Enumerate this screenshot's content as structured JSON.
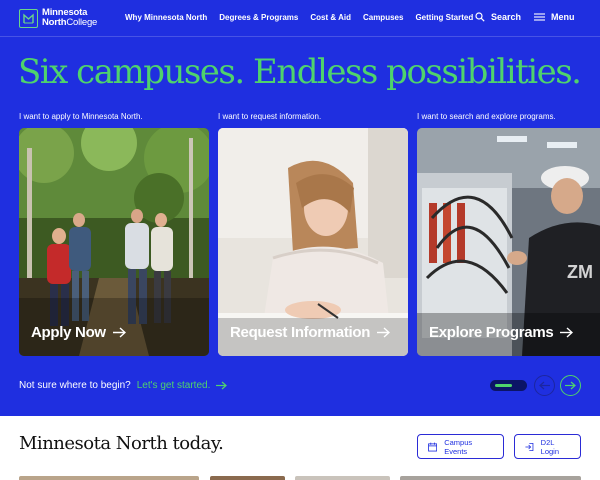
{
  "header": {
    "logo_line1": "Minnesota",
    "logo_line2_bold": "North",
    "logo_line2_regular": "College",
    "nav": [
      "Why Minnesota North",
      "Degrees & Programs",
      "Cost & Aid",
      "Campuses",
      "Getting Started"
    ],
    "search_label": "Search",
    "menu_label": "Menu"
  },
  "hero": {
    "headline": "Six campuses. Endless possibilities.",
    "cards": [
      {
        "prompt": "I want to apply to Minnesota North.",
        "label": "Apply Now"
      },
      {
        "prompt": "I want to request information.",
        "label": "Request Information"
      },
      {
        "prompt": "I want to search and explore programs.",
        "label": "Explore Programs"
      }
    ],
    "help_text": "Not sure where to begin?",
    "help_link": "Let's get started.",
    "carousel_progress": 0.45
  },
  "today": {
    "title": "Minnesota North today.",
    "events_label": "Campus Events",
    "d2l_label": "D2L Login"
  },
  "colors": {
    "hero_bg": "#1f2fe0",
    "accent_green": "#4fd36c",
    "brand_blue": "#2b2bd6"
  },
  "icons": [
    "logo-mark-icon",
    "search-icon",
    "menu-icon",
    "arrow-right-icon",
    "arrow-left-icon",
    "calendar-icon",
    "login-icon"
  ]
}
